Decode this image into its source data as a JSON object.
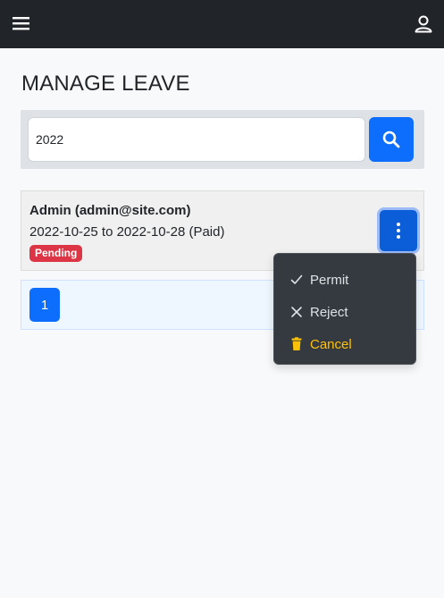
{
  "header": {
    "menu_icon": "hamburger-icon",
    "user_icon": "user-icon"
  },
  "page": {
    "title": "MANAGE LEAVE"
  },
  "search": {
    "value": "2022",
    "button_icon": "search-icon",
    "button_color": "#0d6efd"
  },
  "leave": {
    "name": "Admin (admin@site.com)",
    "dates": "2022-10-25 to 2022-10-28 (Paid)",
    "status": "Pending",
    "status_color": "#dc3545",
    "actions_icon": "kebab-vertical-icon"
  },
  "pagination": {
    "pages": [
      "1"
    ]
  },
  "actions_menu": {
    "items": [
      {
        "label": "Permit",
        "icon": "check-icon"
      },
      {
        "label": "Reject",
        "icon": "x-icon"
      },
      {
        "label": "Cancel",
        "icon": "trash-icon",
        "color": "#ffc107"
      }
    ]
  }
}
